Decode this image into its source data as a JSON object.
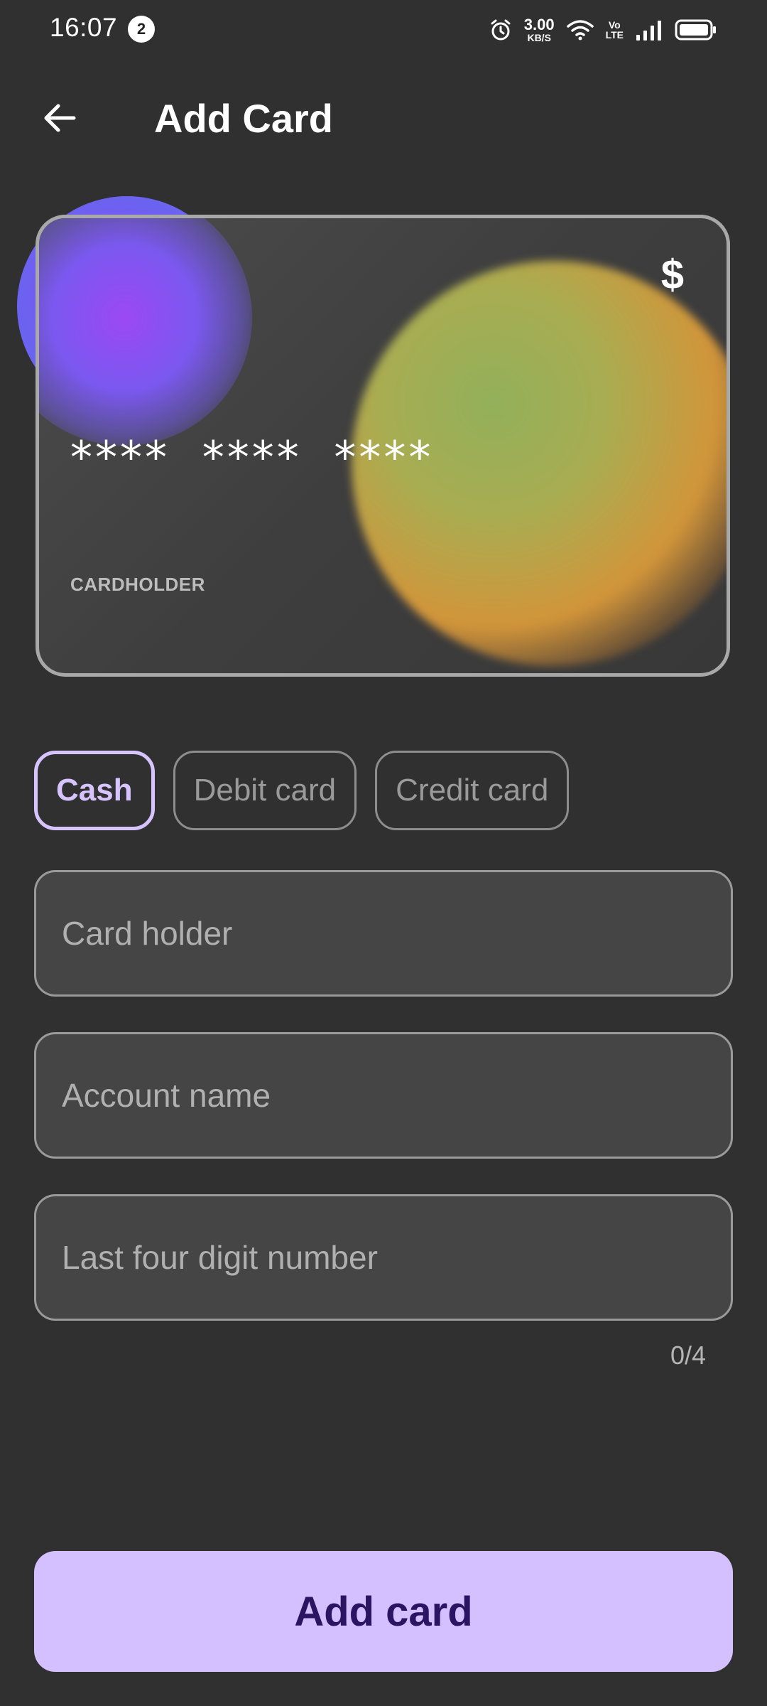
{
  "status_bar": {
    "time": "16:07",
    "notification_count": "2",
    "speed_value": "3.00",
    "speed_unit": "KB/S",
    "volte_top": "Vo",
    "volte_bottom": "LTE",
    "icons": [
      "alarm-icon",
      "wifi-icon",
      "signal-icon",
      "battery-icon"
    ]
  },
  "header": {
    "title": "Add Card",
    "back_icon": "arrow-left-icon"
  },
  "card_preview": {
    "currency_symbol": "$",
    "number_mask": "****  ****  ****",
    "holder_label": "CARDHOLDER"
  },
  "payment_types": {
    "selected": "Cash",
    "options": [
      "Cash",
      "Debit card",
      "Credit card"
    ]
  },
  "form": {
    "card_holder_placeholder": "Card holder",
    "account_name_placeholder": "Account name",
    "last_four_placeholder": "Last four digit number",
    "last_four_counter": "0/4"
  },
  "actions": {
    "add_card_label": "Add card"
  },
  "colors": {
    "background": "#303030",
    "accent": "#d4bfff",
    "button_text": "#2b1462"
  }
}
